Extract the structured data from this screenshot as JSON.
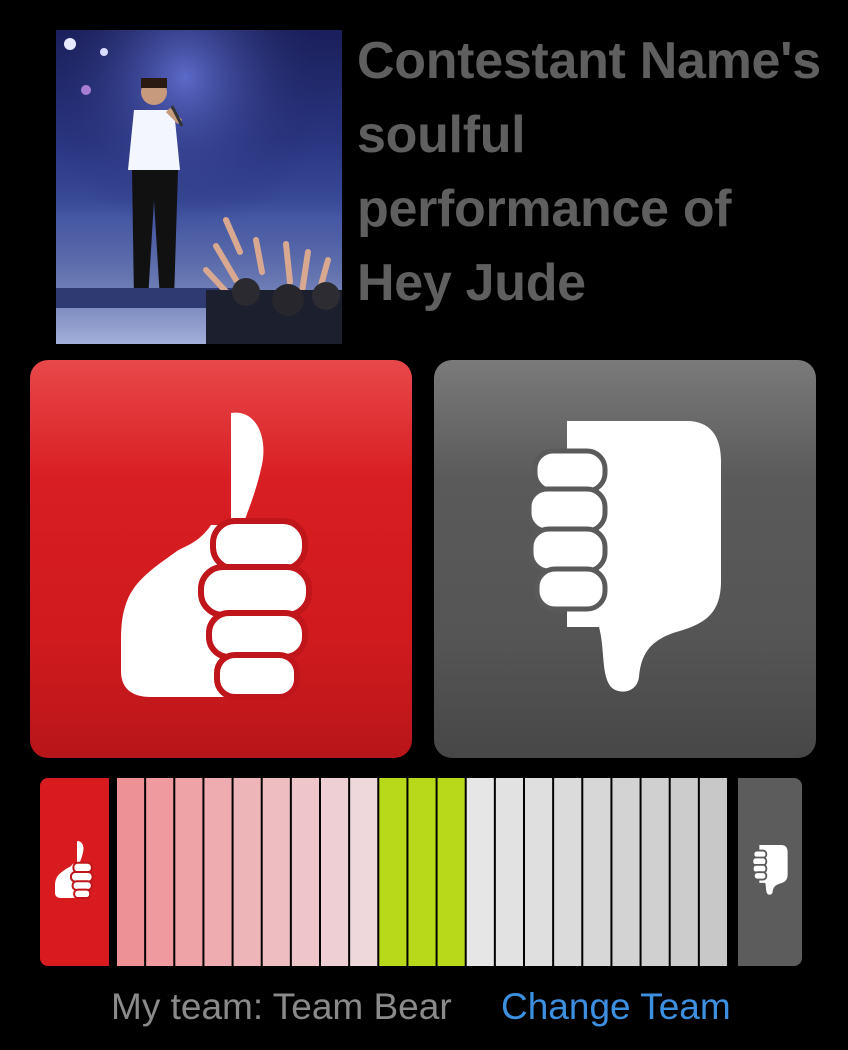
{
  "performance": {
    "title": "Contestant Name's soulful performance of Hey Jude"
  },
  "vote": {
    "like_icon": "thumbs-up-icon",
    "dislike_icon": "thumbs-down-icon",
    "like_color": "#d81b1f",
    "dislike_color": "#5c5c5c"
  },
  "meter": {
    "position_fraction": 0.47,
    "highlight_color": "#b8d81a"
  },
  "footer": {
    "team_label": "My team: Team Bear",
    "change_team_label": "Change Team",
    "link_color": "#3d8fe0"
  }
}
